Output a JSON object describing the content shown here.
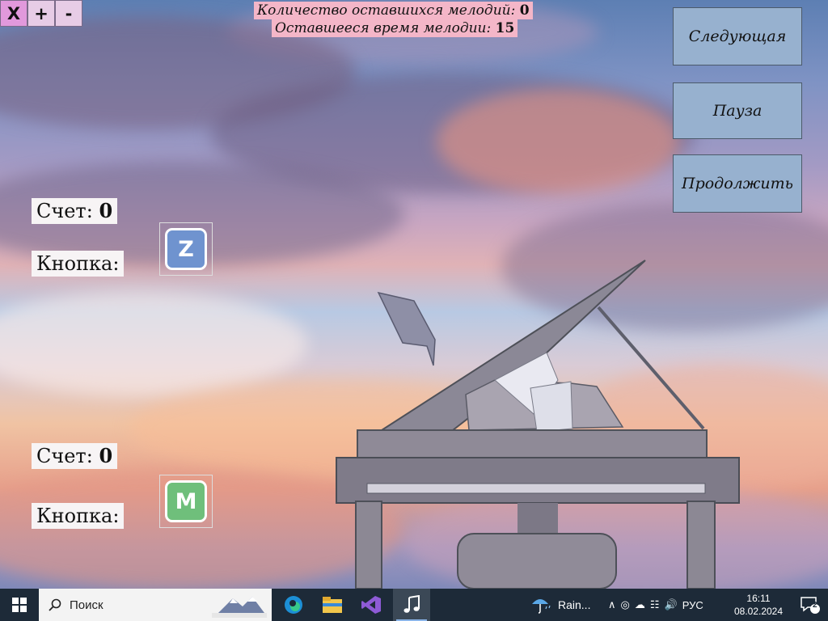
{
  "window_controls": {
    "close_label": "X",
    "plus_label": "+",
    "minus_label": "-"
  },
  "status": {
    "remaining_melodies_label": "Количество оставшихся мелодий:",
    "remaining_melodies_value": "0",
    "remaining_time_label": "Оставшееся время мелодии:",
    "remaining_time_value": "15"
  },
  "buttons": {
    "next_label": "Следующая",
    "pause_label": "Пауза",
    "resume_label": "Продолжить"
  },
  "players": [
    {
      "score_label": "Счет:",
      "score_value": "0",
      "key_label": "Кнопка:",
      "key_letter": "Z",
      "key_color": "#6f93cf"
    },
    {
      "score_label": "Счет:",
      "score_value": "0",
      "key_label": "Кнопка:",
      "key_letter": "M",
      "key_color": "#6fbf7b"
    }
  ],
  "taskbar": {
    "search_placeholder": "Поиск",
    "apps": [
      "edge-icon",
      "file-explorer-icon",
      "visual-studio-icon",
      "music-note-icon"
    ],
    "weather_text": "Rain...",
    "language": "РУС",
    "time": "16:11",
    "date": "08.02.2024",
    "notification_count": "2"
  }
}
